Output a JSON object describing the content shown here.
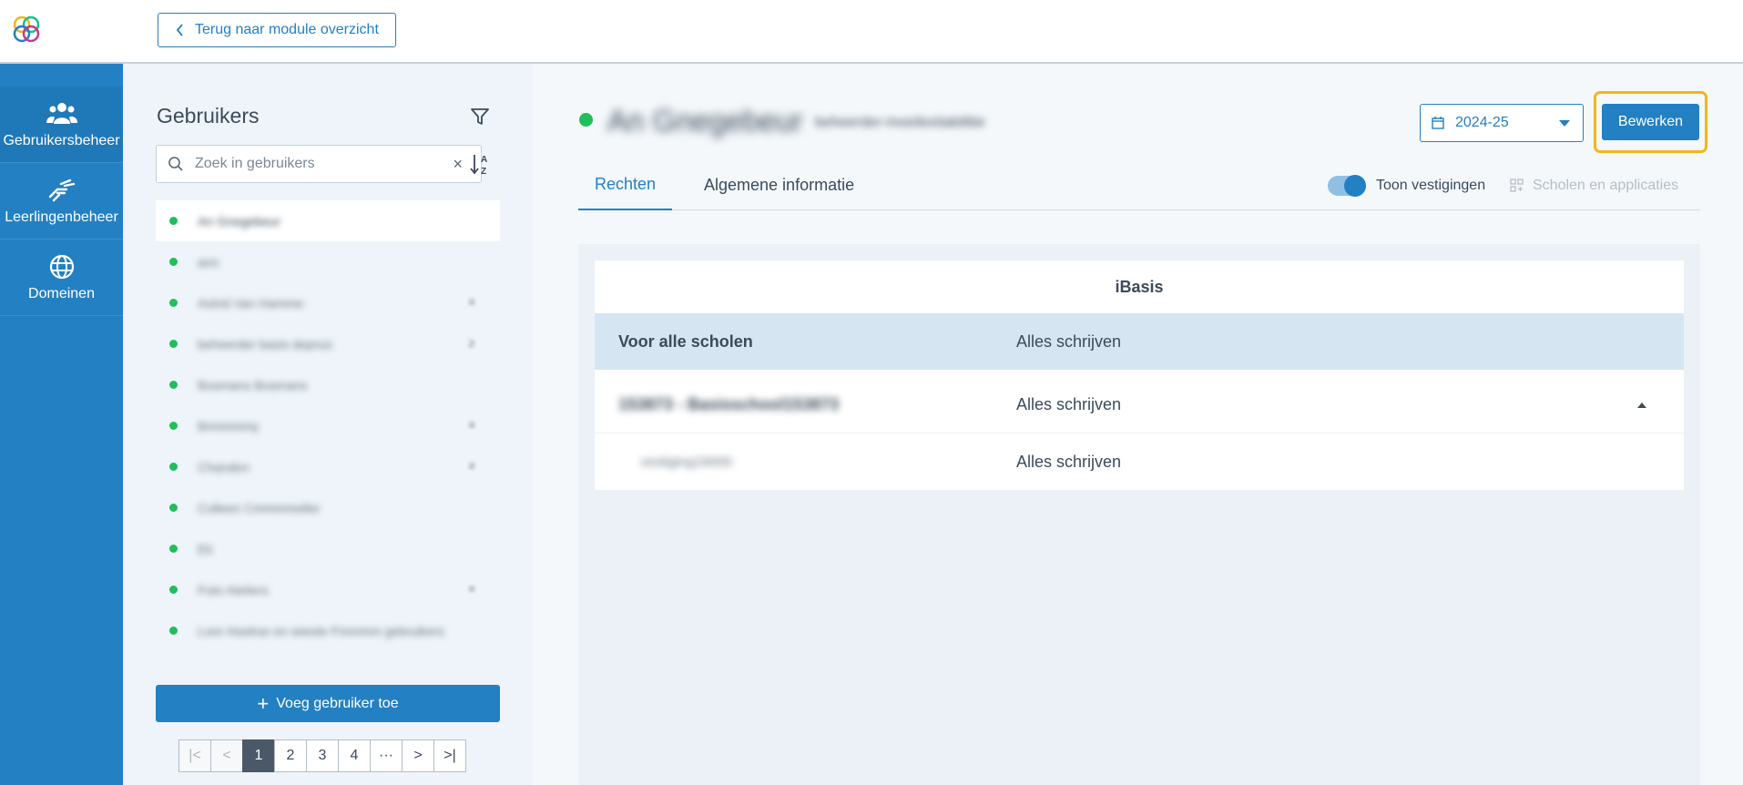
{
  "header": {
    "back_label": "Terug naar module overzicht"
  },
  "nav": {
    "items": [
      {
        "label": "Gebruikersbeheer",
        "icon": "users-icon"
      },
      {
        "label": "Leerlingenbeheer",
        "icon": "hand-icon"
      },
      {
        "label": "Domeinen",
        "icon": "globe-icon"
      }
    ]
  },
  "users_panel": {
    "title": "Gebruikers",
    "search_placeholder": "Zoek in gebruikers",
    "clear": "×",
    "users": [
      {
        "name": "An Gnegebeur",
        "trail": ""
      },
      {
        "name": "ann",
        "trail": ""
      },
      {
        "name": "Astrid Van Hamme",
        "trail": "≡"
      },
      {
        "name": "beheerder basis depruo",
        "trail": "≥"
      },
      {
        "name": "Bosmans Bosmans",
        "trail": ""
      },
      {
        "name": "Brmmmmy",
        "trail": "≡"
      },
      {
        "name": "Chandon",
        "trail": "≡"
      },
      {
        "name": "Colleen Cmmmmeller",
        "trail": ""
      },
      {
        "name": "Eit",
        "trail": ""
      },
      {
        "name": "Foto Ateliers",
        "trail": "≡"
      },
      {
        "name": "Lore Hoekse en wieste Fmmmm gebruikers",
        "trail": ""
      }
    ],
    "add_user_label": "Voeg gebruiker toe",
    "pagination": {
      "first": "|<",
      "prev": "<",
      "pages": [
        "1",
        "2",
        "3",
        "4"
      ],
      "ellipsis": "···",
      "next": ">",
      "last": ">|",
      "current": "1"
    }
  },
  "main": {
    "user_name": "An Gnegebeur",
    "user_role": "beheerder-moeilexitabilitie",
    "year": "2024-25",
    "edit_label": "Bewerken",
    "tabs": [
      {
        "label": "Rechten"
      },
      {
        "label": "Algemene informatie"
      }
    ],
    "toggle_label": "Toon vestigingen",
    "apps_label": "Scholen en applicaties",
    "table": {
      "title": "iBasis",
      "header_row": {
        "name": "Voor alle scholen",
        "right": "Alles schrijven"
      },
      "school_row": {
        "name": "153873 - Basisschool153873",
        "right": "Alles schrijven"
      },
      "sub_row": {
        "name": "vestiging19000",
        "right": "Alles schrijven"
      }
    }
  },
  "colors": {
    "primary": "#2380c2",
    "highlight": "#f5b41c",
    "status_green": "#1fbf5a"
  }
}
